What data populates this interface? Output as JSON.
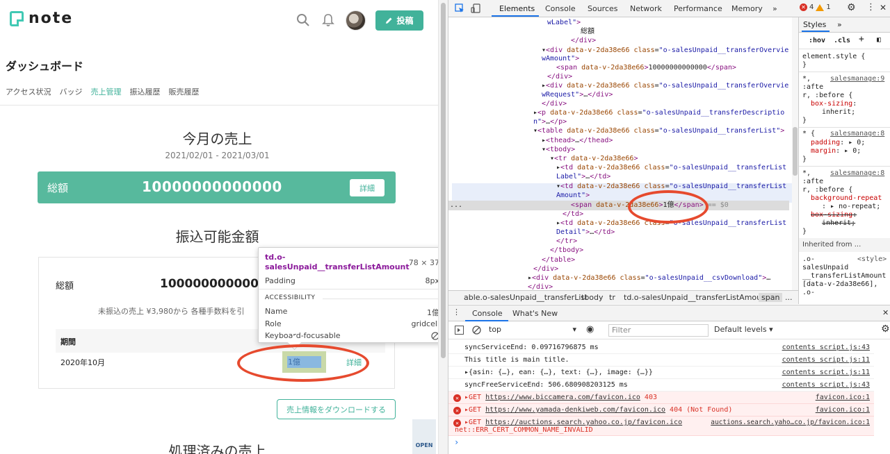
{
  "note": {
    "logo_text": "note",
    "post_button": "投稿",
    "dashboard_title": "ダッシュボード",
    "subtabs": [
      "アクセス状況",
      "バッジ",
      "売上管理",
      "振込履歴",
      "販売履歴"
    ],
    "monthly": {
      "title": "今月の売上",
      "period": "2021/02/01 - 2021/03/01",
      "total_label": "総額",
      "total_amount": "10000000000000",
      "detail_button": "詳細"
    },
    "transferable": {
      "title": "振込可能金額",
      "total_label": "総額",
      "total_amount": "1000000000000",
      "note_text": "未振込の売上 ¥3,980から 各種手数料を引",
      "col_period": "期間",
      "row_period": "2020年10月",
      "row_amount": "1億",
      "row_detail": "詳細"
    },
    "download_button": "売上情報をダウンロードする",
    "processed_title": "処理済みの売上",
    "open_badge": "OPEN"
  },
  "tooltip": {
    "selector": "td.o-salesUnpaid__transferListAmount",
    "size": "78 × 37",
    "padding_label": "Padding",
    "padding_value": "8px",
    "section": "ACCESSIBILITY",
    "name_label": "Name",
    "name_value": "1億",
    "role_label": "Role",
    "role_value": "gridcell",
    "kb_label": "Keyboard-focusable"
  },
  "devtools": {
    "tabs": [
      "Elements",
      "Console",
      "Sources",
      "Network",
      "Performance",
      "Memory",
      "»"
    ],
    "errors": "4",
    "warnings": "1",
    "breadcrumbs": [
      "able.o-salesUnpaid__transferList",
      "tbody",
      "tr",
      "td.o-salesUnpaid__transferListAmount",
      "span",
      "..."
    ],
    "styles": {
      "tabs": [
        "Styles",
        "»"
      ],
      "filter_hov": ":hov",
      "filter_cls": ".cls",
      "inherited_from": "Inherited from ...",
      "element_style": "element.style {",
      "src1": "salesmanage:9",
      "src2": "salesmanage:8",
      "src3": "salesmanage:8",
      "style_tag": "<style>"
    },
    "console_tabs": [
      "Console",
      "What's New"
    ],
    "context": "top",
    "filter_placeholder": "Filter",
    "levels": "Default levels ▾",
    "logs": [
      {
        "msg": "syncServiceEnd: 0.09716796875 ms",
        "src": "contents script.js:43"
      },
      {
        "msg": "This title is main title.",
        "src": "contents script.js:11"
      },
      {
        "msg": "▸{asin: {…}, ean: {…}, text: {…}, image: {…}}",
        "src": "contents script.js:11"
      },
      {
        "msg": "syncFreeServiceEnd: 506.680908203125 ms",
        "src": "contents script.js:43"
      }
    ],
    "errors_list": [
      {
        "method": "▸GET",
        "url": "https://www.biccamera.com/favicon.ico",
        "status": "403",
        "src": "favicon.ico:1"
      },
      {
        "method": "▸GET",
        "url": "https://www.yamada-denkiweb.com/favicon.ico",
        "status": "404 (Not Found)",
        "src": "favicon.ico:1"
      },
      {
        "method": "▸GET",
        "url": "https://auctions.search.yahoo.co.jp/favicon.ico",
        "status": "",
        "src": "auctions.search.yaho…co.jp/favicon.ico:1",
        "extra": "net::ERR_CERT_COMMON_NAME_INVALID"
      }
    ],
    "prompt": "›"
  }
}
